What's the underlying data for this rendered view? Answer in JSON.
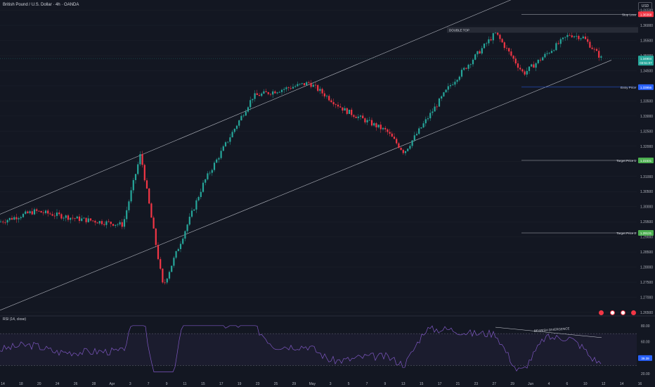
{
  "header": {
    "title": "British Pound / U.S. Dollar · 4h · OANDA",
    "currency": "USD"
  },
  "colors": {
    "background": "#131722",
    "up_candle": "#26a69a",
    "down_candle": "#f23645",
    "stop_loss": "#f23645",
    "target": "#4caf50",
    "entry": "#2962ff",
    "rsi_line": "#7e57c2"
  },
  "chart_data": [
    {
      "type": "line",
      "title": "British Pound / U.S. Dollar · 4h · OANDA",
      "y_axis_labels": [
        "1.36500",
        "1.36000",
        "1.35500",
        "1.35000",
        "1.34500",
        "1.34000",
        "1.33500",
        "1.33000",
        "1.32500",
        "1.32000",
        "1.31500",
        "1.31000",
        "1.30500",
        "1.30000",
        "1.29500",
        "1.29000",
        "1.28500",
        "1.28000",
        "1.27500",
        "1.27000",
        "1.26500"
      ],
      "ylim": [
        1.265,
        1.367
      ],
      "x_tick_labels": [
        "14",
        "18",
        "20",
        "24",
        "26",
        "28",
        "Apr",
        "3",
        "7",
        "9",
        "11",
        "15",
        "17",
        "19",
        "23",
        "25",
        "29",
        "May",
        "3",
        "5",
        "7",
        "9",
        "13",
        "15",
        "17",
        "21",
        "23",
        "27",
        "29",
        "Jun",
        "4",
        "6",
        "10",
        "12",
        "14",
        "16"
      ],
      "price_path": {
        "x": [
          "Mar 14",
          "Mar 20",
          "Mar 26",
          "Apr 2",
          "Apr 5",
          "Apr 10",
          "Apr 16",
          "Apr 22",
          "Apr 29",
          "May 3",
          "May 9",
          "May 13",
          "May 20",
          "May 24",
          "May 29",
          "Jun 4",
          "Jun 7",
          "Jun 10"
        ],
        "y": [
          1.295,
          1.2985,
          1.296,
          1.294,
          1.3175,
          1.2735,
          1.308,
          1.3365,
          1.341,
          1.332,
          1.325,
          1.318,
          1.34,
          1.3575,
          1.344,
          1.357,
          1.356,
          1.349
        ]
      },
      "current_price": "1.34904",
      "countdown": "03:51:07",
      "channel": [
        "upper trend line",
        "lower trend line"
      ],
      "annotations": [
        {
          "text": "DOUBLE TOP",
          "price": 1.3585
        },
        {
          "text": "Stop Loss",
          "value_label": "1.36368",
          "value": 1.36368
        },
        {
          "text": "Entry Price",
          "value_label": "1.33956",
          "value": 1.33956
        },
        {
          "text": "Target Price 1",
          "value_label": "1.31531",
          "value": 1.31531
        },
        {
          "text": "Target Price 2",
          "value_label": "1.29131",
          "value": 1.29131
        }
      ]
    },
    {
      "type": "line",
      "title": "RSI (14, close)",
      "ylim": [
        19,
        86
      ],
      "y_axis_labels": [
        "80.00",
        "60.00",
        "20.00"
      ],
      "current_value": "39.39",
      "levels": [
        70,
        30
      ],
      "annotations": [
        {
          "text": "BEARISH DIVERGENCE"
        }
      ]
    }
  ]
}
